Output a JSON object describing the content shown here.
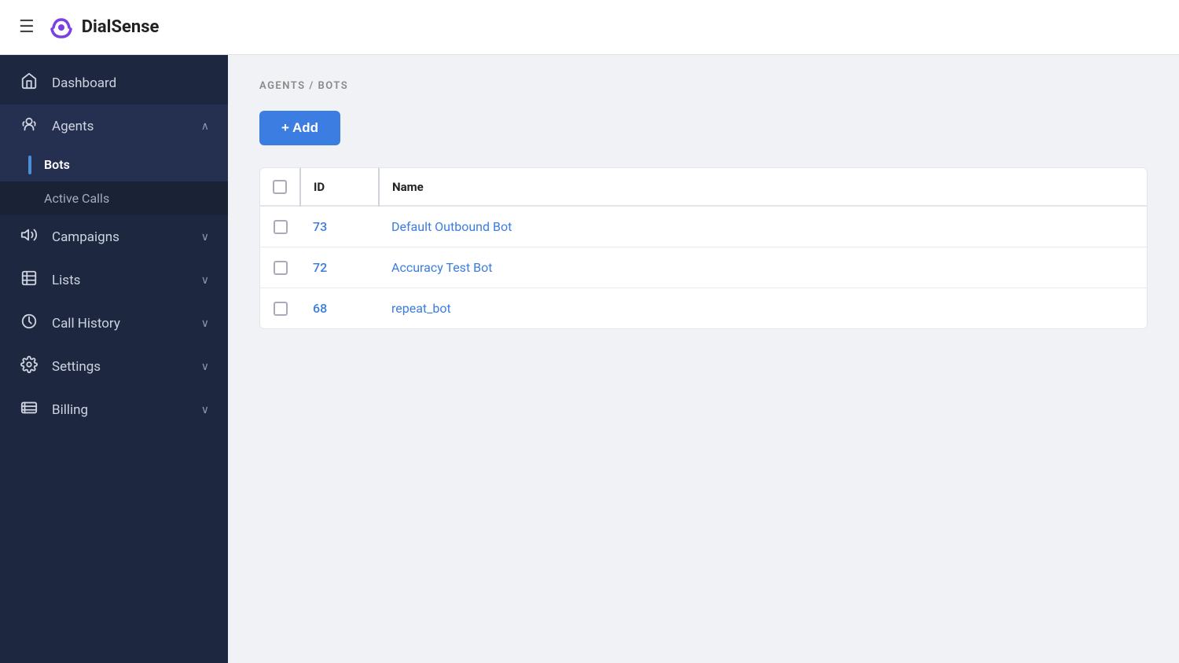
{
  "topbar": {
    "hamburger_icon": "☰",
    "logo_text": "DialSense"
  },
  "sidebar": {
    "items": [
      {
        "id": "dashboard",
        "label": "Dashboard",
        "icon": "🏠",
        "expandable": false,
        "active": false
      },
      {
        "id": "agents",
        "label": "Agents",
        "icon": "headset",
        "expandable": true,
        "active": true,
        "chevron": "∧",
        "children": [
          {
            "id": "bots",
            "label": "Bots",
            "active": true
          },
          {
            "id": "active-calls",
            "label": "Active Calls",
            "active": false
          }
        ]
      },
      {
        "id": "campaigns",
        "label": "Campaigns",
        "icon": "📢",
        "expandable": true,
        "active": false,
        "chevron": "∨"
      },
      {
        "id": "lists",
        "label": "Lists",
        "icon": "list",
        "expandable": true,
        "active": false,
        "chevron": "∨"
      },
      {
        "id": "call-history",
        "label": "Call History",
        "icon": "history",
        "expandable": true,
        "active": false,
        "chevron": "∨"
      },
      {
        "id": "settings",
        "label": "Settings",
        "icon": "settings",
        "expandable": true,
        "active": false,
        "chevron": "∨"
      },
      {
        "id": "billing",
        "label": "Billing",
        "icon": "billing",
        "expandable": true,
        "active": false,
        "chevron": "∨"
      }
    ]
  },
  "breadcrumb": {
    "parts": [
      "AGENTS",
      "/",
      "BOTS"
    ]
  },
  "toolbar": {
    "add_label": "+ Add"
  },
  "table": {
    "columns": [
      {
        "id": "checkbox",
        "label": ""
      },
      {
        "id": "id",
        "label": "ID"
      },
      {
        "id": "name",
        "label": "Name"
      }
    ],
    "rows": [
      {
        "id": "73",
        "name": "Default Outbound Bot"
      },
      {
        "id": "72",
        "name": "Accuracy Test Bot"
      },
      {
        "id": "68",
        "name": "repeat_bot"
      }
    ]
  }
}
